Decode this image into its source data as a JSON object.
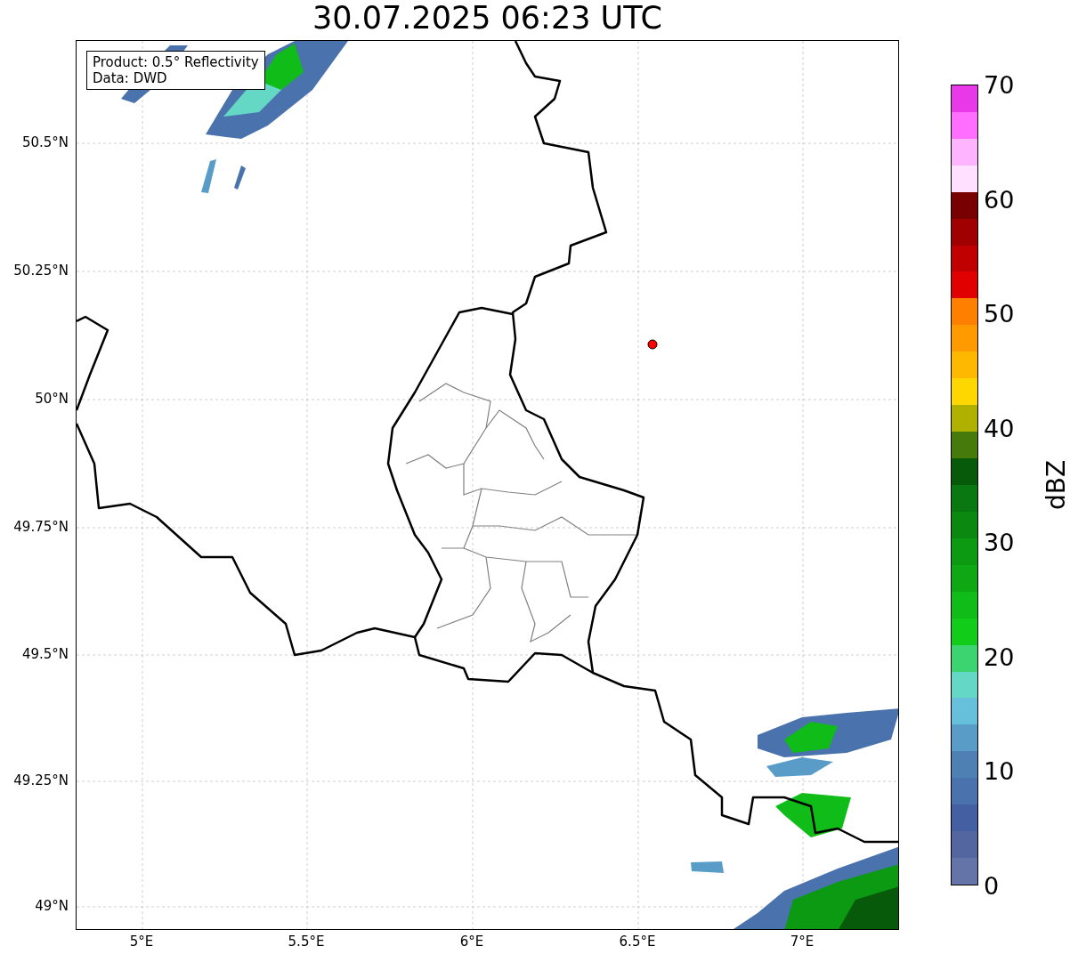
{
  "title": "30.07.2025 06:23 UTC",
  "info_box": [
    "Product: 0.5° Reflectivity",
    "Data: DWD"
  ],
  "map": {
    "lat_ticks": [
      "50.5°N",
      "50.25°N",
      "50°N",
      "49.75°N",
      "49.5°N",
      "49.25°N",
      "49°N"
    ],
    "lon_ticks": [
      "5°E",
      "5.5°E",
      "6°E",
      "6.5°E",
      "7°E"
    ]
  },
  "colorbar": {
    "label": "dBZ",
    "ticks": [
      "70",
      "60",
      "50",
      "40",
      "30",
      "20",
      "10",
      "0"
    ],
    "bands": [
      {
        "color": "#6474a8"
      },
      {
        "color": "#5466a0"
      },
      {
        "color": "#4460a2"
      },
      {
        "color": "#4a72ac"
      },
      {
        "color": "#4e80b4"
      },
      {
        "color": "#5a9cc8"
      },
      {
        "color": "#66c0dc"
      },
      {
        "color": "#64d8c4"
      },
      {
        "color": "#3cd470"
      },
      {
        "color": "#12cc1a"
      },
      {
        "color": "#10bc18"
      },
      {
        "color": "#0ea814"
      },
      {
        "color": "#0c9a12"
      },
      {
        "color": "#0a8810"
      },
      {
        "color": "#0a7810"
      },
      {
        "color": "#065a0a"
      },
      {
        "color": "#467a0a"
      },
      {
        "color": "#b0b000"
      },
      {
        "color": "#ffd700"
      },
      {
        "color": "#ffb800"
      },
      {
        "color": "#ff9a00"
      },
      {
        "color": "#ff7f00"
      },
      {
        "color": "#e00000"
      },
      {
        "color": "#c00000"
      },
      {
        "color": "#a00000"
      },
      {
        "color": "#780000"
      },
      {
        "color": "#ffe0ff"
      },
      {
        "color": "#ffb4ff"
      },
      {
        "color": "#ff6eff"
      },
      {
        "color": "#e838e8"
      }
    ]
  }
}
